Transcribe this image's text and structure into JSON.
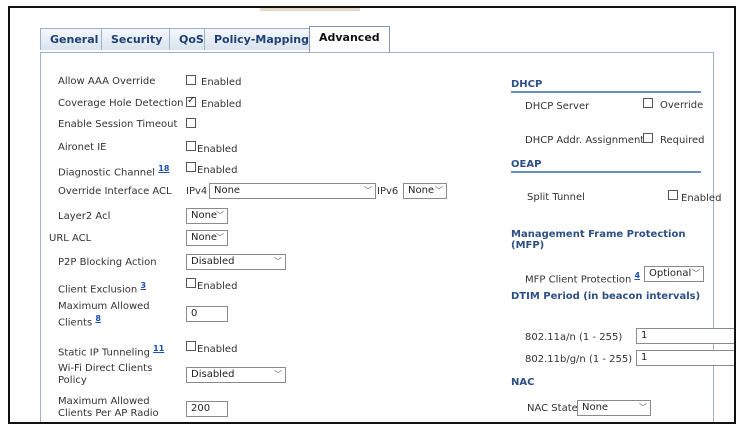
{
  "tabs": [
    {
      "label": "General"
    },
    {
      "label": "Security"
    },
    {
      "label": "QoS"
    },
    {
      "label": "Policy-Mapping"
    },
    {
      "label": "Advanced"
    }
  ],
  "left": {
    "allow_aaa_override": {
      "label": "Allow AAA Override",
      "cb_text": "Enabled",
      "checked": false
    },
    "coverage_hole": {
      "label": "Coverage Hole Detection",
      "cb_text": "Enabled",
      "checked": true
    },
    "session_timeout": {
      "label": "Enable Session Timeout",
      "checked": false
    },
    "aironet_ie": {
      "label": "Aironet IE",
      "cb_text": "Enabled",
      "checked": false
    },
    "diag_channel": {
      "label": "Diagnostic Channel",
      "link": "18",
      "cb_text": "Enabled",
      "checked": false
    },
    "override_acl": {
      "label": "Override Interface ACL",
      "ipv4_label": "IPv4",
      "ipv4_value": "None",
      "ipv6_label": "IPv6",
      "ipv6_value": "None"
    },
    "layer2_acl": {
      "label": "Layer2 Acl",
      "value": "None"
    },
    "url_acl": {
      "label": "URL ACL",
      "value": "None"
    },
    "p2p": {
      "label": "P2P Blocking Action",
      "value": "Disabled"
    },
    "client_exclusion": {
      "label": "Client Exclusion",
      "link": "3",
      "cb_text": "Enabled",
      "checked": false
    },
    "max_clients": {
      "label_line1": "Maximum Allowed",
      "label_line2": "Clients",
      "link": "8",
      "value": "0"
    },
    "static_ip": {
      "label": "Static IP Tunneling",
      "link": "11",
      "cb_text": "Enabled",
      "checked": false
    },
    "wifi_direct": {
      "label_line1": "Wi-Fi Direct Clients",
      "label_line2": "Policy",
      "value": "Disabled"
    },
    "max_per_radio": {
      "label_line1": "Maximum Allowed",
      "label_line2": "Clients Per AP Radio",
      "value": "200"
    }
  },
  "right": {
    "dhcp": {
      "title": "DHCP",
      "server_label": "DHCP Server",
      "server_cb": "Override",
      "addr_label": "DHCP Addr. Assignment",
      "addr_cb": "Required"
    },
    "oeap": {
      "title": "OEAP",
      "split_label": "Split Tunnel",
      "split_cb": "Enabled"
    },
    "mfp": {
      "title": "Management Frame Protection (MFP)",
      "client_label": "MFP Client Protection",
      "link": "4",
      "value": "Optional"
    },
    "dtim": {
      "title": "DTIM Period (in beacon intervals)",
      "a_label": "802.11a/n (1 - 255)",
      "a_value": "1",
      "b_label": "802.11b/g/n (1 - 255)",
      "b_value": "1"
    },
    "nac": {
      "title": "NAC",
      "state_label": "NAC State",
      "state_value": "None"
    }
  }
}
